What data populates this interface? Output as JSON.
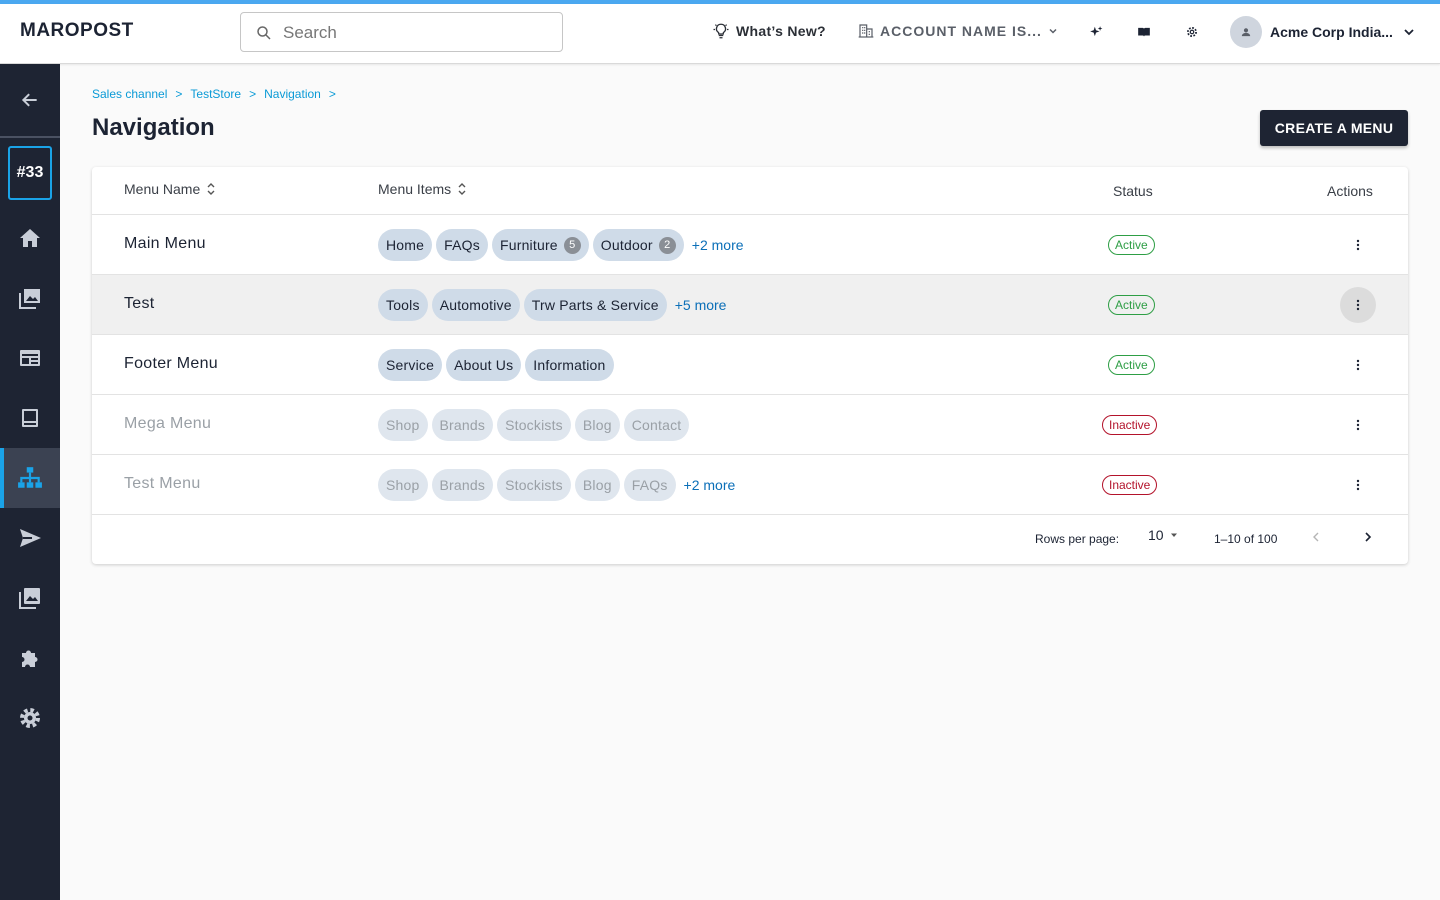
{
  "header": {
    "logo": "MAROPOST",
    "search_placeholder": "Search",
    "whats_new": "What’s New?",
    "account_name": "ACCOUNT NAME IS...",
    "user_name": "Acme Corp India..."
  },
  "sidebar": {
    "badge": "#33",
    "items": [
      {
        "icon": "back-arrow-icon"
      },
      {
        "icon": "home-icon"
      },
      {
        "icon": "media-icon"
      },
      {
        "icon": "layout-icon"
      },
      {
        "icon": "content-icon"
      },
      {
        "icon": "sitemap-icon",
        "active": true
      },
      {
        "icon": "send-icon"
      },
      {
        "icon": "gallery-icon"
      },
      {
        "icon": "puzzle-icon"
      },
      {
        "icon": "gear-icon"
      }
    ]
  },
  "breadcrumb": [
    "Sales channel",
    "TestStore",
    "Navigation"
  ],
  "page": {
    "title": "Navigation",
    "create_button": "CREATE A MENU"
  },
  "table": {
    "columns": {
      "name": "Menu Name",
      "items": "Menu Items",
      "status": "Status",
      "actions": "Actions"
    },
    "rows": [
      {
        "name": "Main Menu",
        "chips": [
          {
            "label": "Home"
          },
          {
            "label": "FAQs"
          },
          {
            "label": "Furniture",
            "count": "5"
          },
          {
            "label": "Outdoor",
            "count": "2"
          }
        ],
        "more": "+2 more",
        "status": "Active",
        "active": true
      },
      {
        "name": "Test",
        "chips": [
          {
            "label": "Tools"
          },
          {
            "label": "Automotive"
          },
          {
            "label": "Trw Parts & Service"
          }
        ],
        "more": "+5 more",
        "status": "Active",
        "active": true,
        "hover": true
      },
      {
        "name": "Footer Menu",
        "chips": [
          {
            "label": "Service"
          },
          {
            "label": "About Us"
          },
          {
            "label": "Information"
          }
        ],
        "more": "",
        "status": "Active",
        "active": true
      },
      {
        "name": "Mega Menu",
        "chips": [
          {
            "label": "Shop"
          },
          {
            "label": "Brands"
          },
          {
            "label": "Stockists"
          },
          {
            "label": "Blog"
          },
          {
            "label": "Contact"
          }
        ],
        "more": "",
        "status": "Inactive",
        "active": false
      },
      {
        "name": "Test Menu",
        "chips": [
          {
            "label": "Shop"
          },
          {
            "label": "Brands"
          },
          {
            "label": "Stockists"
          },
          {
            "label": "Blog"
          },
          {
            "label": "FAQs"
          }
        ],
        "more": "+2 more",
        "status": "Inactive",
        "active": false
      }
    ]
  },
  "pagination": {
    "rows_per_page_label": "Rows per page:",
    "rows_per_page": "10",
    "range": "1–10 of 100"
  },
  "colors": {
    "sidebar_bg": "#1e2433",
    "accent": "#1aa3e8",
    "active_status": "#2e9e45",
    "inactive_status": "#b3132b",
    "chip_bg": "#cfdbe8",
    "link": "#0b6fb8"
  }
}
